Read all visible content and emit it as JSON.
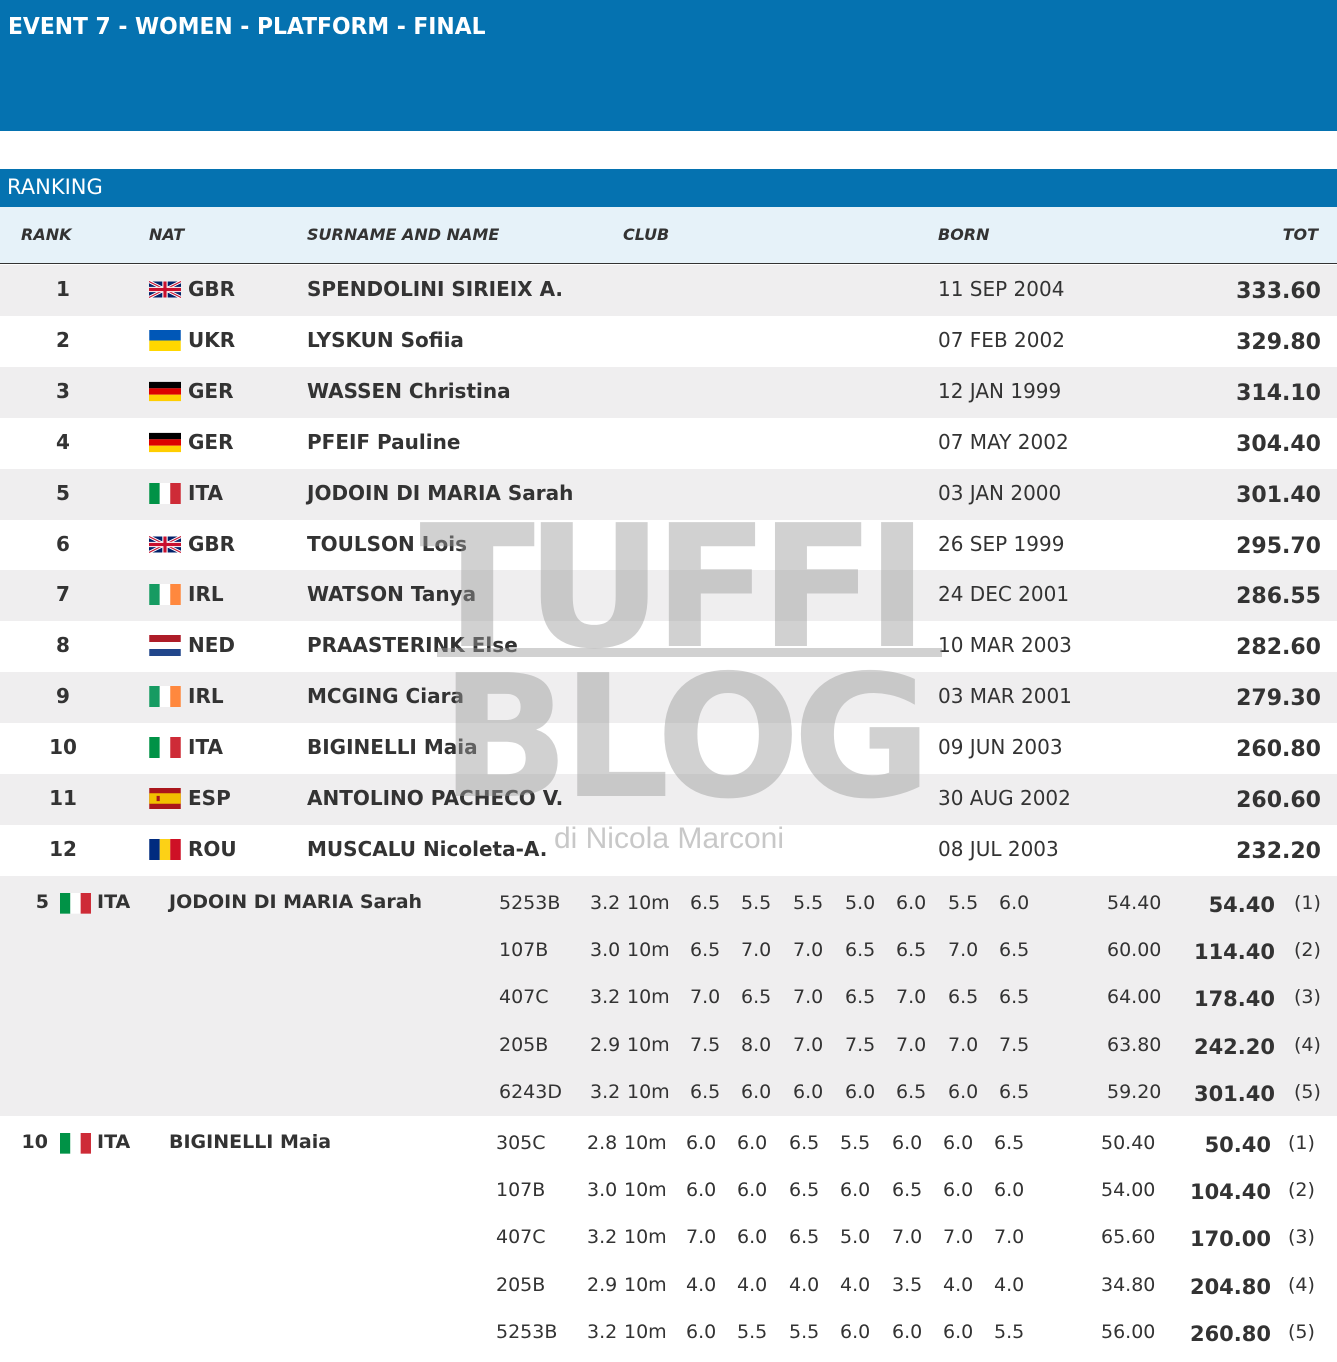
{
  "header": {
    "title": "EVENT 7 - WOMEN - PLATFORM - FINAL"
  },
  "ranking": {
    "title": "RANKING",
    "columns": {
      "rank": "RANK",
      "nat": "NAT",
      "name": "SURNAME AND NAME",
      "club": "CLUB",
      "born": "BORN",
      "tot": "TOT"
    },
    "rows": [
      {
        "rank": "1",
        "nat": "GBR",
        "flag": "flag-gbr-icon",
        "name": "SPENDOLINI SIRIEIX A.",
        "born": "11 SEP 2004",
        "tot": "333.60"
      },
      {
        "rank": "2",
        "nat": "UKR",
        "flag": "flag-ukr-icon",
        "name": "LYSKUN Sofiia",
        "born": "07 FEB 2002",
        "tot": "329.80"
      },
      {
        "rank": "3",
        "nat": "GER",
        "flag": "flag-ger-icon",
        "name": "WASSEN Christina",
        "born": "12 JAN 1999",
        "tot": "314.10"
      },
      {
        "rank": "4",
        "nat": "GER",
        "flag": "flag-ger-icon",
        "name": "PFEIF Pauline",
        "born": "07 MAY 2002",
        "tot": "304.40"
      },
      {
        "rank": "5",
        "nat": "ITA",
        "flag": "flag-ita-icon",
        "name": "JODOIN DI MARIA Sarah",
        "born": "03 JAN 2000",
        "tot": "301.40"
      },
      {
        "rank": "6",
        "nat": "GBR",
        "flag": "flag-gbr-icon",
        "name": "TOULSON Lois",
        "born": "26 SEP 1999",
        "tot": "295.70"
      },
      {
        "rank": "7",
        "nat": "IRL",
        "flag": "flag-irl-icon",
        "name": "WATSON Tanya",
        "born": "24 DEC 2001",
        "tot": "286.55"
      },
      {
        "rank": "8",
        "nat": "NED",
        "flag": "flag-ned-icon",
        "name": "PRAASTERINK Else",
        "born": "10 MAR 2003",
        "tot": "282.60"
      },
      {
        "rank": "9",
        "nat": "IRL",
        "flag": "flag-irl-icon",
        "name": "MCGING Ciara",
        "born": "03 MAR 2001",
        "tot": "279.30"
      },
      {
        "rank": "10",
        "nat": "ITA",
        "flag": "flag-ita-icon",
        "name": "BIGINELLI Maia",
        "born": "09 JUN 2003",
        "tot": "260.80"
      },
      {
        "rank": "11",
        "nat": "ESP",
        "flag": "flag-esp-icon",
        "name": "ANTOLINO PACHECO V.",
        "born": "30 AUG 2002",
        "tot": "260.60"
      },
      {
        "rank": "12",
        "nat": "ROU",
        "flag": "flag-rou-icon",
        "name": "MUSCALU Nicoleta-A.",
        "born": "08 JUL 2003",
        "tot": "232.20"
      }
    ]
  },
  "details": [
    {
      "rank": "5",
      "nat": "ITA",
      "flag": "flag-ita-icon",
      "name": "JODOIN DI MARIA Sarah",
      "dives": [
        {
          "code": "5253B",
          "dd": "3.2",
          "height": "10m",
          "judges": [
            "6.5",
            "5.5",
            "5.5",
            "5.0",
            "6.0",
            "5.5",
            "6.0"
          ],
          "points": "54.40",
          "cumulative": "54.40",
          "round": "(1)"
        },
        {
          "code": "107B",
          "dd": "3.0",
          "height": "10m",
          "judges": [
            "6.5",
            "7.0",
            "7.0",
            "6.5",
            "6.5",
            "7.0",
            "6.5"
          ],
          "points": "60.00",
          "cumulative": "114.40",
          "round": "(2)"
        },
        {
          "code": "407C",
          "dd": "3.2",
          "height": "10m",
          "judges": [
            "7.0",
            "6.5",
            "7.0",
            "6.5",
            "7.0",
            "6.5",
            "6.5"
          ],
          "points": "64.00",
          "cumulative": "178.40",
          "round": "(3)"
        },
        {
          "code": "205B",
          "dd": "2.9",
          "height": "10m",
          "judges": [
            "7.5",
            "8.0",
            "7.0",
            "7.5",
            "7.0",
            "7.0",
            "7.5"
          ],
          "points": "63.80",
          "cumulative": "242.20",
          "round": "(4)"
        },
        {
          "code": "6243D",
          "dd": "3.2",
          "height": "10m",
          "judges": [
            "6.5",
            "6.0",
            "6.0",
            "6.0",
            "6.5",
            "6.0",
            "6.5"
          ],
          "points": "59.20",
          "cumulative": "301.40",
          "round": "(5)"
        }
      ]
    },
    {
      "rank": "10",
      "nat": "ITA",
      "flag": "flag-ita-icon",
      "name": "BIGINELLI Maia",
      "dives": [
        {
          "code": "305C",
          "dd": "2.8",
          "height": "10m",
          "judges": [
            "6.0",
            "6.0",
            "6.5",
            "5.5",
            "6.0",
            "6.0",
            "6.5"
          ],
          "points": "50.40",
          "cumulative": "50.40",
          "round": "(1)"
        },
        {
          "code": "107B",
          "dd": "3.0",
          "height": "10m",
          "judges": [
            "6.0",
            "6.0",
            "6.5",
            "6.0",
            "6.5",
            "6.0",
            "6.0"
          ],
          "points": "54.00",
          "cumulative": "104.40",
          "round": "(2)"
        },
        {
          "code": "407C",
          "dd": "3.2",
          "height": "10m",
          "judges": [
            "7.0",
            "6.0",
            "6.5",
            "5.0",
            "7.0",
            "7.0",
            "7.0"
          ],
          "points": "65.60",
          "cumulative": "170.00",
          "round": "(3)"
        },
        {
          "code": "205B",
          "dd": "2.9",
          "height": "10m",
          "judges": [
            "4.0",
            "4.0",
            "4.0",
            "4.0",
            "3.5",
            "4.0",
            "4.0"
          ],
          "points": "34.80",
          "cumulative": "204.80",
          "round": "(4)"
        },
        {
          "code": "5253B",
          "dd": "3.2",
          "height": "10m",
          "judges": [
            "6.0",
            "5.5",
            "5.5",
            "6.0",
            "6.0",
            "6.0",
            "5.5"
          ],
          "points": "56.00",
          "cumulative": "260.80",
          "round": "(5)"
        }
      ]
    }
  ],
  "watermark": {
    "line1": "TUFFI",
    "line2": "BLOG",
    "byline": "di Nicola Marconi"
  },
  "colors": {
    "brand": "#0572b0",
    "header_row_bg": "#e6f2f9",
    "alt_row_bg": "#efeeef"
  }
}
